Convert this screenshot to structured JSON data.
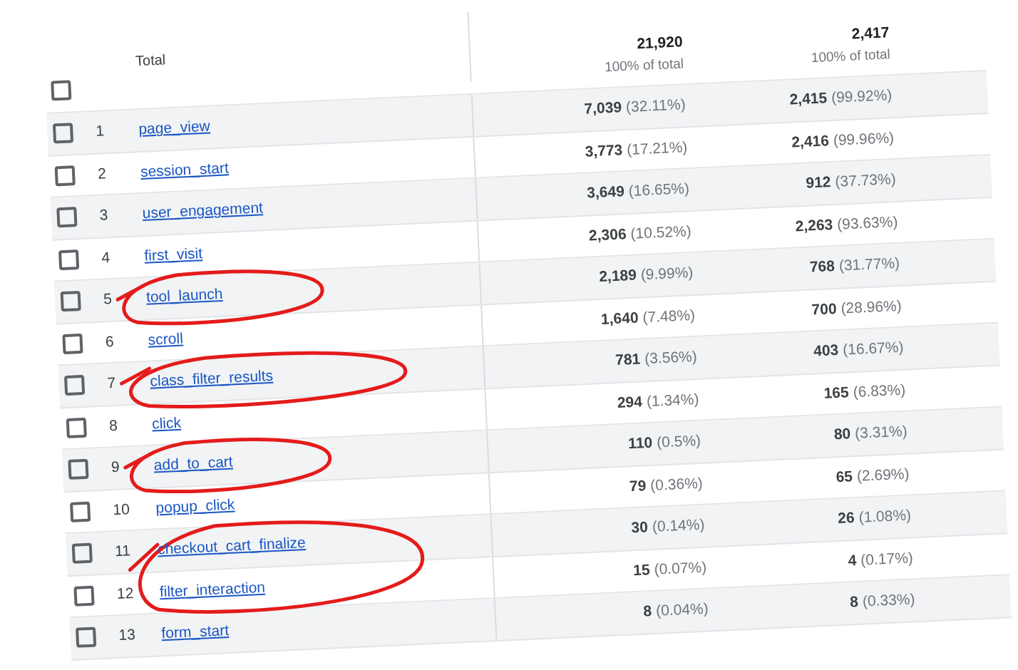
{
  "header": {
    "label": "Total",
    "column_2": {
      "value": "21,920",
      "share": "100% of total"
    },
    "column_3": {
      "value": "2,417",
      "share": "100% of total"
    },
    "checked": false
  },
  "rows": [
    {
      "index": "1",
      "name": "page_view",
      "column_2": {
        "value": "7,039",
        "share": "(32.11%)"
      },
      "column_3": {
        "value": "2,415",
        "share": "(99.92%)"
      },
      "checked": false,
      "circled": false
    },
    {
      "index": "2",
      "name": "session_start",
      "column_2": {
        "value": "3,773",
        "share": "(17.21%)"
      },
      "column_3": {
        "value": "2,416",
        "share": "(99.96%)"
      },
      "checked": false,
      "circled": false
    },
    {
      "index": "3",
      "name": "user_engagement",
      "column_2": {
        "value": "3,649",
        "share": "(16.65%)"
      },
      "column_3": {
        "value": "912",
        "share": "(37.73%)"
      },
      "checked": false,
      "circled": false
    },
    {
      "index": "4",
      "name": "first_visit",
      "column_2": {
        "value": "2,306",
        "share": "(10.52%)"
      },
      "column_3": {
        "value": "2,263",
        "share": "(93.63%)"
      },
      "checked": false,
      "circled": false
    },
    {
      "index": "5",
      "name": "tool_launch",
      "column_2": {
        "value": "2,189",
        "share": "(9.99%)"
      },
      "column_3": {
        "value": "768",
        "share": "(31.77%)"
      },
      "checked": false,
      "circled": true
    },
    {
      "index": "6",
      "name": "scroll",
      "column_2": {
        "value": "1,640",
        "share": "(7.48%)"
      },
      "column_3": {
        "value": "700",
        "share": "(28.96%)"
      },
      "checked": false,
      "circled": false
    },
    {
      "index": "7",
      "name": "class_filter_results",
      "column_2": {
        "value": "781",
        "share": "(3.56%)"
      },
      "column_3": {
        "value": "403",
        "share": "(16.67%)"
      },
      "checked": false,
      "circled": true
    },
    {
      "index": "8",
      "name": "click",
      "column_2": {
        "value": "294",
        "share": "(1.34%)"
      },
      "column_3": {
        "value": "165",
        "share": "(6.83%)"
      },
      "checked": false,
      "circled": false
    },
    {
      "index": "9",
      "name": "add_to_cart",
      "column_2": {
        "value": "110",
        "share": "(0.5%)"
      },
      "column_3": {
        "value": "80",
        "share": "(3.31%)"
      },
      "checked": false,
      "circled": true
    },
    {
      "index": "10",
      "name": "popup_click",
      "column_2": {
        "value": "79",
        "share": "(0.36%)"
      },
      "column_3": {
        "value": "65",
        "share": "(2.69%)"
      },
      "checked": false,
      "circled": false
    },
    {
      "index": "11",
      "name": "checkout_cart_finalize",
      "column_2": {
        "value": "30",
        "share": "(0.14%)"
      },
      "column_3": {
        "value": "26",
        "share": "(1.08%)"
      },
      "checked": false,
      "circled": true
    },
    {
      "index": "12",
      "name": "filter_interaction",
      "column_2": {
        "value": "15",
        "share": "(0.07%)"
      },
      "column_3": {
        "value": "4",
        "share": "(0.17%)"
      },
      "checked": false,
      "circled": true
    },
    {
      "index": "13",
      "name": "form_start",
      "column_2": {
        "value": "8",
        "share": "(0.04%)"
      },
      "column_3": {
        "value": "8",
        "share": "(0.33%)"
      },
      "checked": false,
      "circled": false
    }
  ]
}
